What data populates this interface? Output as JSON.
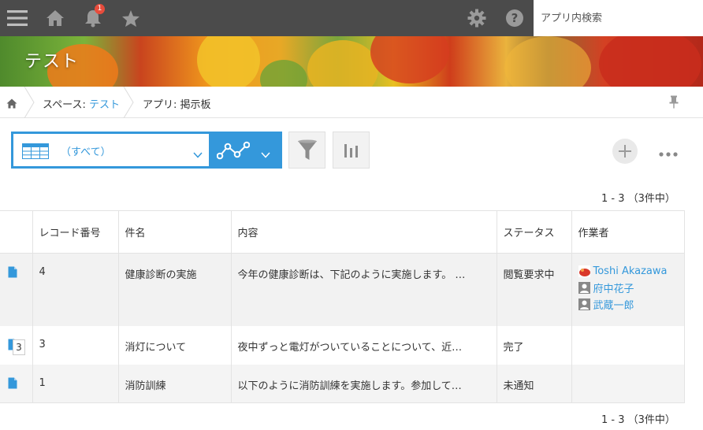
{
  "header": {
    "notification_count": "1",
    "search_placeholder": "アプリ内検索"
  },
  "banner": {
    "title": "テスト"
  },
  "breadcrumb": {
    "space_prefix": "スペース: ",
    "space_name": "テスト",
    "app_text": "アプリ: 掲示板"
  },
  "toolbar": {
    "view_label": "（すべて）"
  },
  "pagination": {
    "top": "1 - 3 （3件中）",
    "bottom": "1 - 3 （3件中）"
  },
  "table": {
    "columns": [
      "レコード番号",
      "件名",
      "内容",
      "ステータス",
      "作業者"
    ],
    "rows": [
      {
        "record_no": "4",
        "subject": "健康診断の実施",
        "content": "今年の健康診断は、下記のように実施します。 …",
        "status": "閲覧要求中",
        "assignees": [
          "Toshi Akazawa",
          "府中花子",
          "武蔵一郎"
        ]
      },
      {
        "record_no": "3",
        "subject": "消灯について",
        "content": "夜中ずっと電灯がついていることについて、近…",
        "status": "完了",
        "stack_count": "3"
      },
      {
        "record_no": "1",
        "subject": "消防訓練",
        "content": "以下のように消防訓練を実施します。参加して…",
        "status": "未通知"
      }
    ]
  },
  "colors": {
    "accent": "#3498db",
    "header_bg": "#4b4b4b",
    "badge": "#e74c3c"
  }
}
